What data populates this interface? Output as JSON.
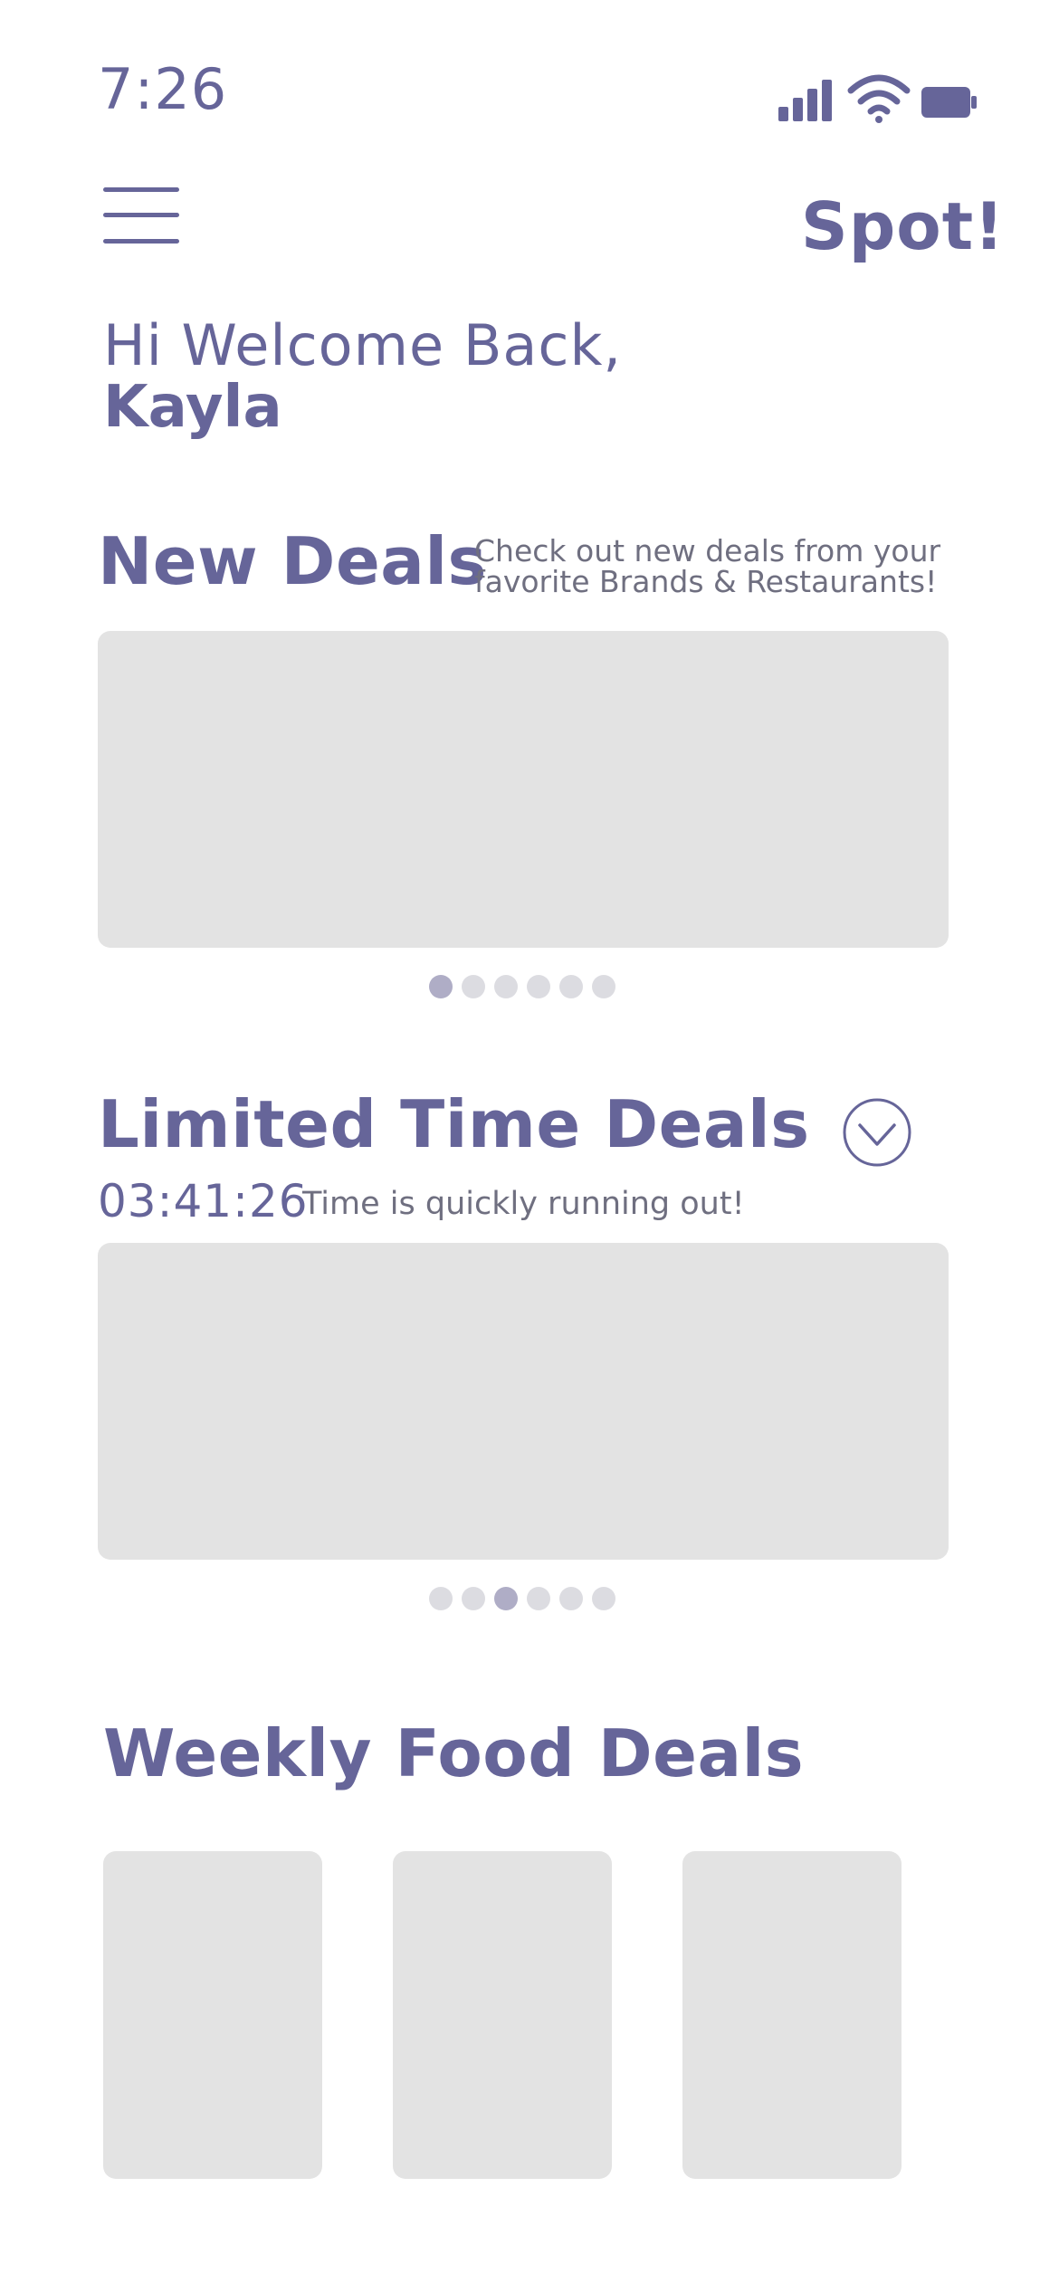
{
  "status_bar": {
    "time": "7:26",
    "icons": [
      "signal-icon",
      "wifi-icon",
      "battery-icon"
    ]
  },
  "header": {
    "menu_icon": "hamburger-menu-icon",
    "brand": "Spot!"
  },
  "greeting": {
    "line": "Hi Welcome Back,",
    "name": "Kayla"
  },
  "new_deals": {
    "title": "New Deals",
    "subtitle_line1": "Check out new deals from your",
    "subtitle_line2": "favorite Brands & Restaurants!",
    "carousel_pages": 6,
    "active_page": 1
  },
  "limited_deals": {
    "title": "Limited Time Deals",
    "expand_icon": "chevron-down-circle-icon",
    "timer": "03:41:26",
    "note": "Time is quickly running out!",
    "carousel_pages": 6,
    "active_page": 3
  },
  "weekly_deals": {
    "title": "Weekly Food Deals",
    "card_count": 3
  },
  "colors": {
    "primary": "#666599",
    "placeholder": "#e3e3e3",
    "dot_inactive": "#dcdce1",
    "dot_active": "#afadc6",
    "muted_text": "#6f6f80"
  }
}
